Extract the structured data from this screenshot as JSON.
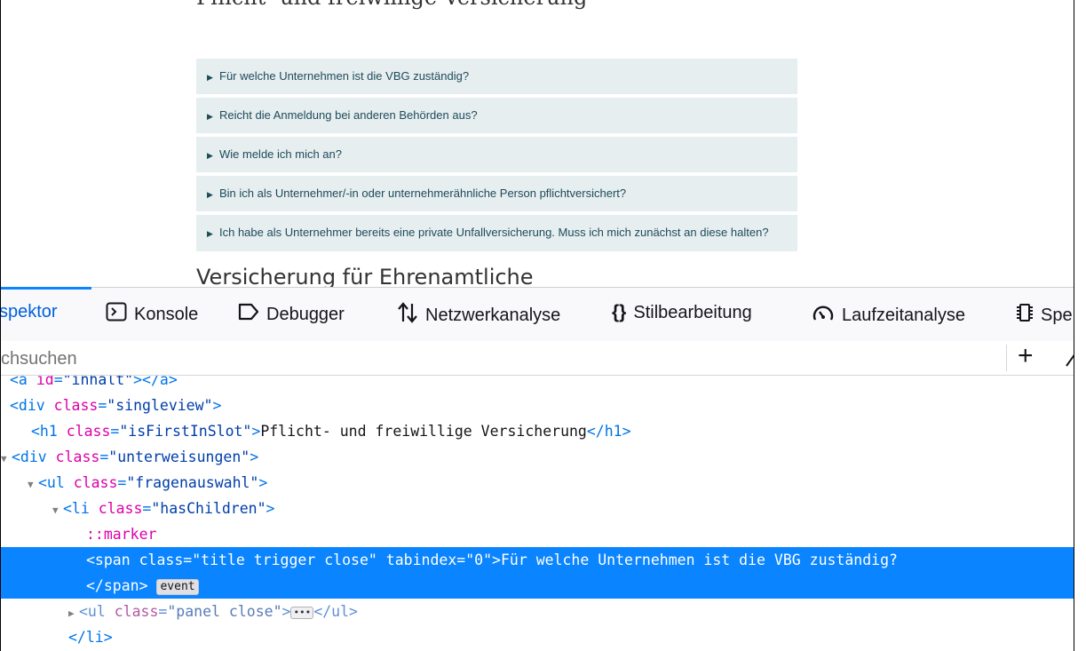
{
  "page": {
    "heading_cut": "Pflicht- und freiwillige Versicherung",
    "faq": [
      "Für welche Unternehmen ist die VBG zuständig?",
      "Reicht die Anmeldung bei anderen Behörden aus?",
      "Wie melde ich mich an?",
      "Bin ich als Unternehmer/-in oder unternehmerähnliche Person pflichtversichert?",
      "Ich habe als Unternehmer bereits eine private Unfallversicherung. Muss ich mich zunächst an diese halten?"
    ],
    "section_heading": "Versicherung für Ehrenamtliche"
  },
  "devtools": {
    "tabs": {
      "inspector": "spektor",
      "console": "Konsole",
      "debugger": "Debugger",
      "network": "Netzwerkanalyse",
      "style_editor": "Stilbearbeitung",
      "performance": "Laufzeitanalyse",
      "memory": "Spe"
    },
    "search_placeholder": "chsuchen",
    "markup": {
      "l0_tag": "<a ",
      "l0_attr": "id",
      "l0_val": "\"inhalt\"",
      "l0_end": "></a>",
      "l1_open": "<div ",
      "l1_attr": "class",
      "l1_val": "\"singleview\"",
      "l1_close": ">",
      "l2_open": "<h1 ",
      "l2_attr": "class",
      "l2_val": "\"isFirstInSlot\"",
      "l2_text": "Pflicht- und freiwillige Versicherung",
      "l2_close": "</h1>",
      "l3_open": "<div ",
      "l3_attr": "class",
      "l3_val": "\"unterweisungen\"",
      "l3_close": ">",
      "l4_open": "<ul ",
      "l4_attr": "class",
      "l4_val": "\"fragenauswahl\"",
      "l4_close": ">",
      "l5_open": "<li ",
      "l5_attr": "class",
      "l5_val": "\"hasChildren\"",
      "l5_close": ">",
      "l6_marker": "::marker",
      "l7_open": "<span ",
      "l7_attr1": "class",
      "l7_val1": "\"title trigger close\"",
      "l7_attr2": "tabindex",
      "l7_val2": "\"0\"",
      "l7_text": "Für welche Unternehmen ist die VBG zuständig?",
      "l8_close": "</span>",
      "l8_badge": "event",
      "l9_open": "<ul ",
      "l9_attr": "class",
      "l9_val": "\"panel close\"",
      "l9_ellipsis": "•••",
      "l9_close": "</ul>",
      "l10_close": "</li>"
    }
  }
}
